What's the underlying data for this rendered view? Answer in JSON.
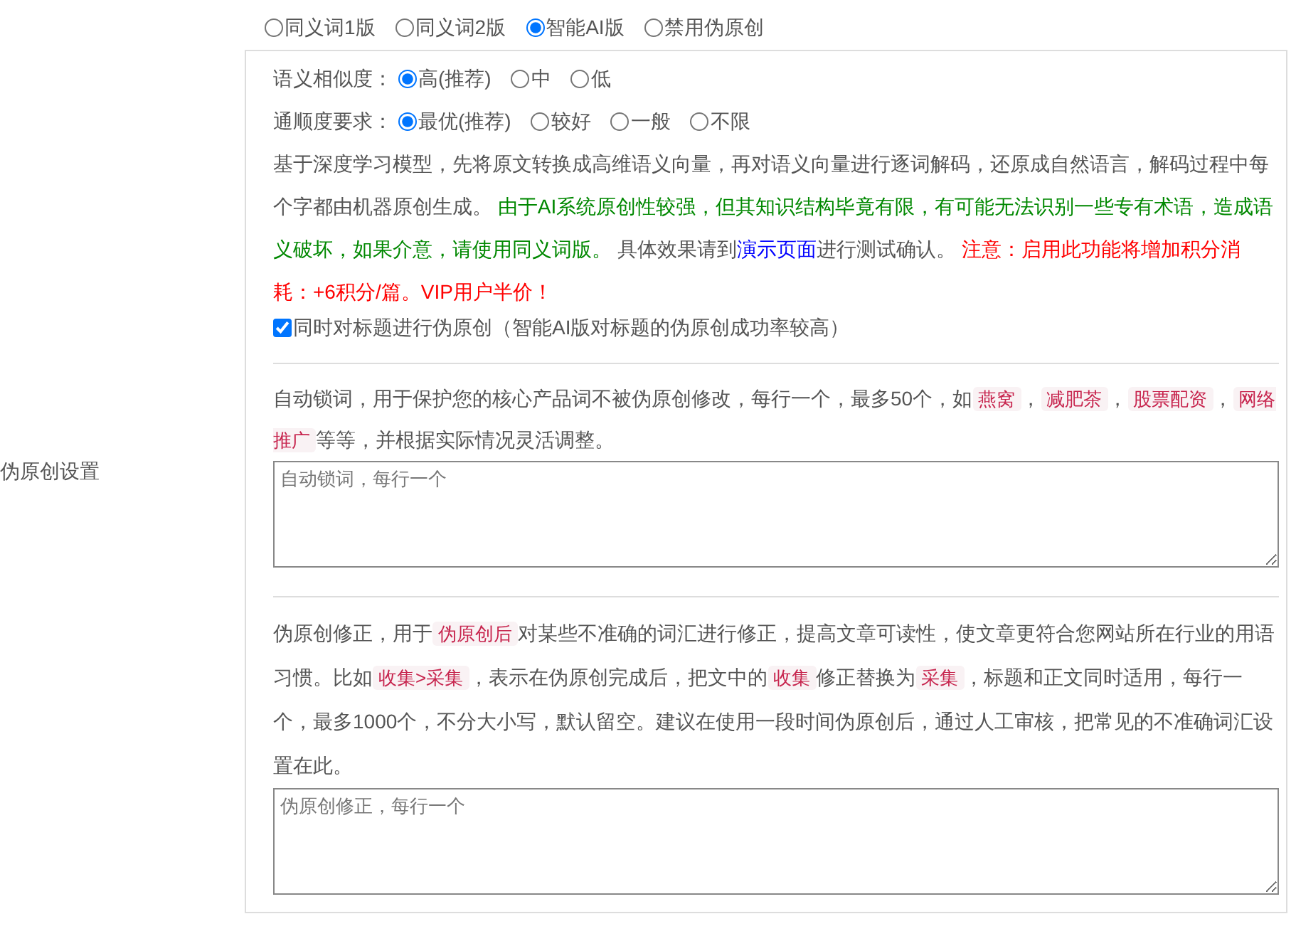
{
  "side_label": "伪原创设置",
  "modes": [
    {
      "label": "同义词1版",
      "selected": false
    },
    {
      "label": "同义词2版",
      "selected": false
    },
    {
      "label": "智能AI版",
      "selected": true
    },
    {
      "label": "禁用伪原创",
      "selected": false
    }
  ],
  "option_rows": [
    {
      "label": "语义相似度：",
      "options": [
        {
          "label": "高(推荐)",
          "selected": true
        },
        {
          "label": "中",
          "selected": false
        },
        {
          "label": "低",
          "selected": false
        }
      ]
    },
    {
      "label": "通顺度要求：",
      "options": [
        {
          "label": "最优(推荐)",
          "selected": true
        },
        {
          "label": "较好",
          "selected": false
        },
        {
          "label": "一般",
          "selected": false
        },
        {
          "label": "不限",
          "selected": false
        }
      ]
    }
  ],
  "ai_note": [
    {
      "kind": "text",
      "text": "基于深度学习模型，先将原文转换成高维语义向量，再对语义向量进行逐词解码，还原成自然语言，解码过程中每个字都由机器原创生成。 "
    },
    {
      "kind": "green",
      "text": "由于AI系统原创性较强，但其知识结构毕竟有限，有可能无法识别一些专有术语，造成语义破坏，如果介意，请使用同义词版。"
    },
    {
      "kind": "text",
      "text": " 具体效果请到"
    },
    {
      "kind": "link",
      "text": "演示页面"
    },
    {
      "kind": "text",
      "text": "进行测试确认。 "
    },
    {
      "kind": "red",
      "text": "注意：启用此功能将增加积分消耗：+6积分/篇。VIP用户半价！"
    }
  ],
  "title_option": {
    "label": "同时对标题进行伪原创（智能AI版对标题的伪原创成功率较高）",
    "checked": true
  },
  "lock_note": [
    {
      "kind": "text",
      "text": "自动锁词，用于保护您的核心产品词不被伪原创修改，每行一个，最多50个，如"
    },
    {
      "kind": "tag",
      "text": "燕窝"
    },
    {
      "kind": "text",
      "text": "，"
    },
    {
      "kind": "tag",
      "text": "减肥茶"
    },
    {
      "kind": "text",
      "text": "，"
    },
    {
      "kind": "tag",
      "text": "股票配资"
    },
    {
      "kind": "text",
      "text": "，"
    },
    {
      "kind": "tag",
      "text": "网络推广"
    },
    {
      "kind": "text",
      "text": "等等，并根据实际情况灵活调整。"
    }
  ],
  "lock_field": {
    "placeholder": "自动锁词，每行一个"
  },
  "fix_note": [
    {
      "kind": "text",
      "text": "伪原创修正，用于"
    },
    {
      "kind": "tag",
      "text": "伪原创后"
    },
    {
      "kind": "text",
      "text": "对某些不准确的词汇进行修正，提高文章可读性，使文章更符合您网站所在行业的用语习惯。比如"
    },
    {
      "kind": "tag",
      "text": "收集>采集"
    },
    {
      "kind": "text",
      "text": "，表示在伪原创完成后，把文中的"
    },
    {
      "kind": "tag",
      "text": "收集"
    },
    {
      "kind": "text",
      "text": "修正替换为"
    },
    {
      "kind": "tag",
      "text": "采集"
    },
    {
      "kind": "text",
      "text": "，标题和正文同时适用，每行一个，最多1000个，不分大小写，默认留空。建议在使用一段时间伪原创后，通过人工审核，把常见的不准确词汇设置在此。"
    }
  ],
  "fix_field": {
    "placeholder": "伪原创修正，每行一个"
  }
}
